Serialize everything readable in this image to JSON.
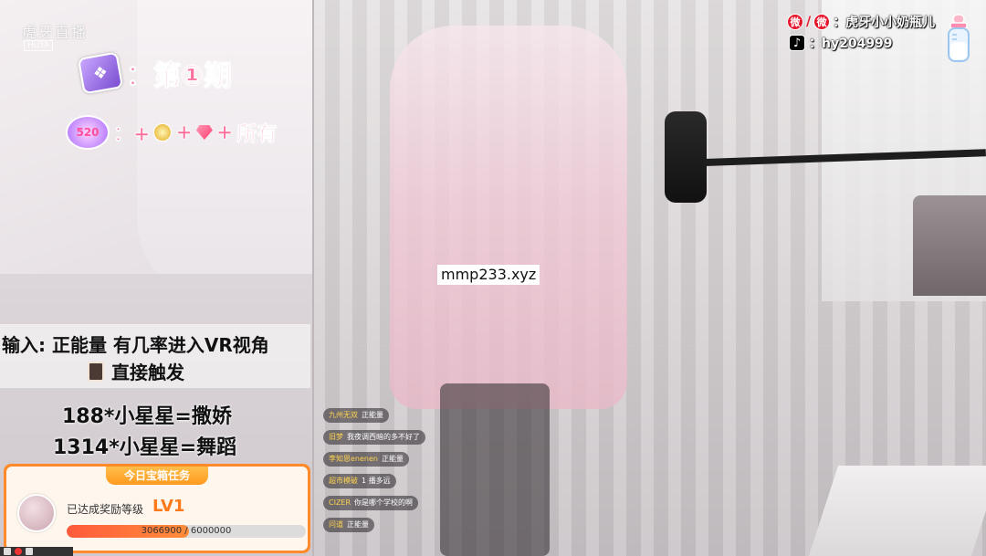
{
  "platform": {
    "logo_text": "虎牙直播",
    "logo_sub": "HUYA"
  },
  "promo": {
    "episode_label": "：第①期",
    "gift_rule": "：+",
    "gift_rule_tail": "所有",
    "gift_badge": "520",
    "instruction_line1": "输入: 正能量  有几率进入VR视角",
    "instruction_line2": "直接触发",
    "price_lines": [
      "188*小星星=撒娇",
      "1314*小星星=舞蹈"
    ]
  },
  "task_panel": {
    "title": "今日宝箱任务",
    "level_label": "已达成奖励等级",
    "level_value": "LV1",
    "progress_current": 3066900,
    "progress_target": 6000000,
    "progress_text": "3066900 / 6000000",
    "accent_color": "#ff8a2b"
  },
  "streamer": {
    "weibo_label": "：虎牙小小奶瓶儿",
    "douyin_label": "：hy204999"
  },
  "watermark": {
    "site": "mmp233.xyz"
  },
  "chat": [
    {
      "user": "九州无双",
      "msg": "正能量"
    },
    {
      "user": "旧梦",
      "msg": "我夜调西暗的多不好了"
    },
    {
      "user": "李知恩enenen",
      "msg": "正能量"
    },
    {
      "user": "超市模破",
      "msg": "1 播多远"
    },
    {
      "user": "CIZER",
      "msg": "你是哪个学校的啊"
    },
    {
      "user": "问道",
      "msg": "正能量"
    }
  ],
  "icons": {
    "book": "purple-book-icon",
    "gift_badge": "gift-badge-icon",
    "coin": "coin-icon",
    "gem": "gem-icon",
    "weibo": "weibo-icon",
    "douyin": "douyin-icon",
    "bottle": "baby-bottle-icon"
  }
}
